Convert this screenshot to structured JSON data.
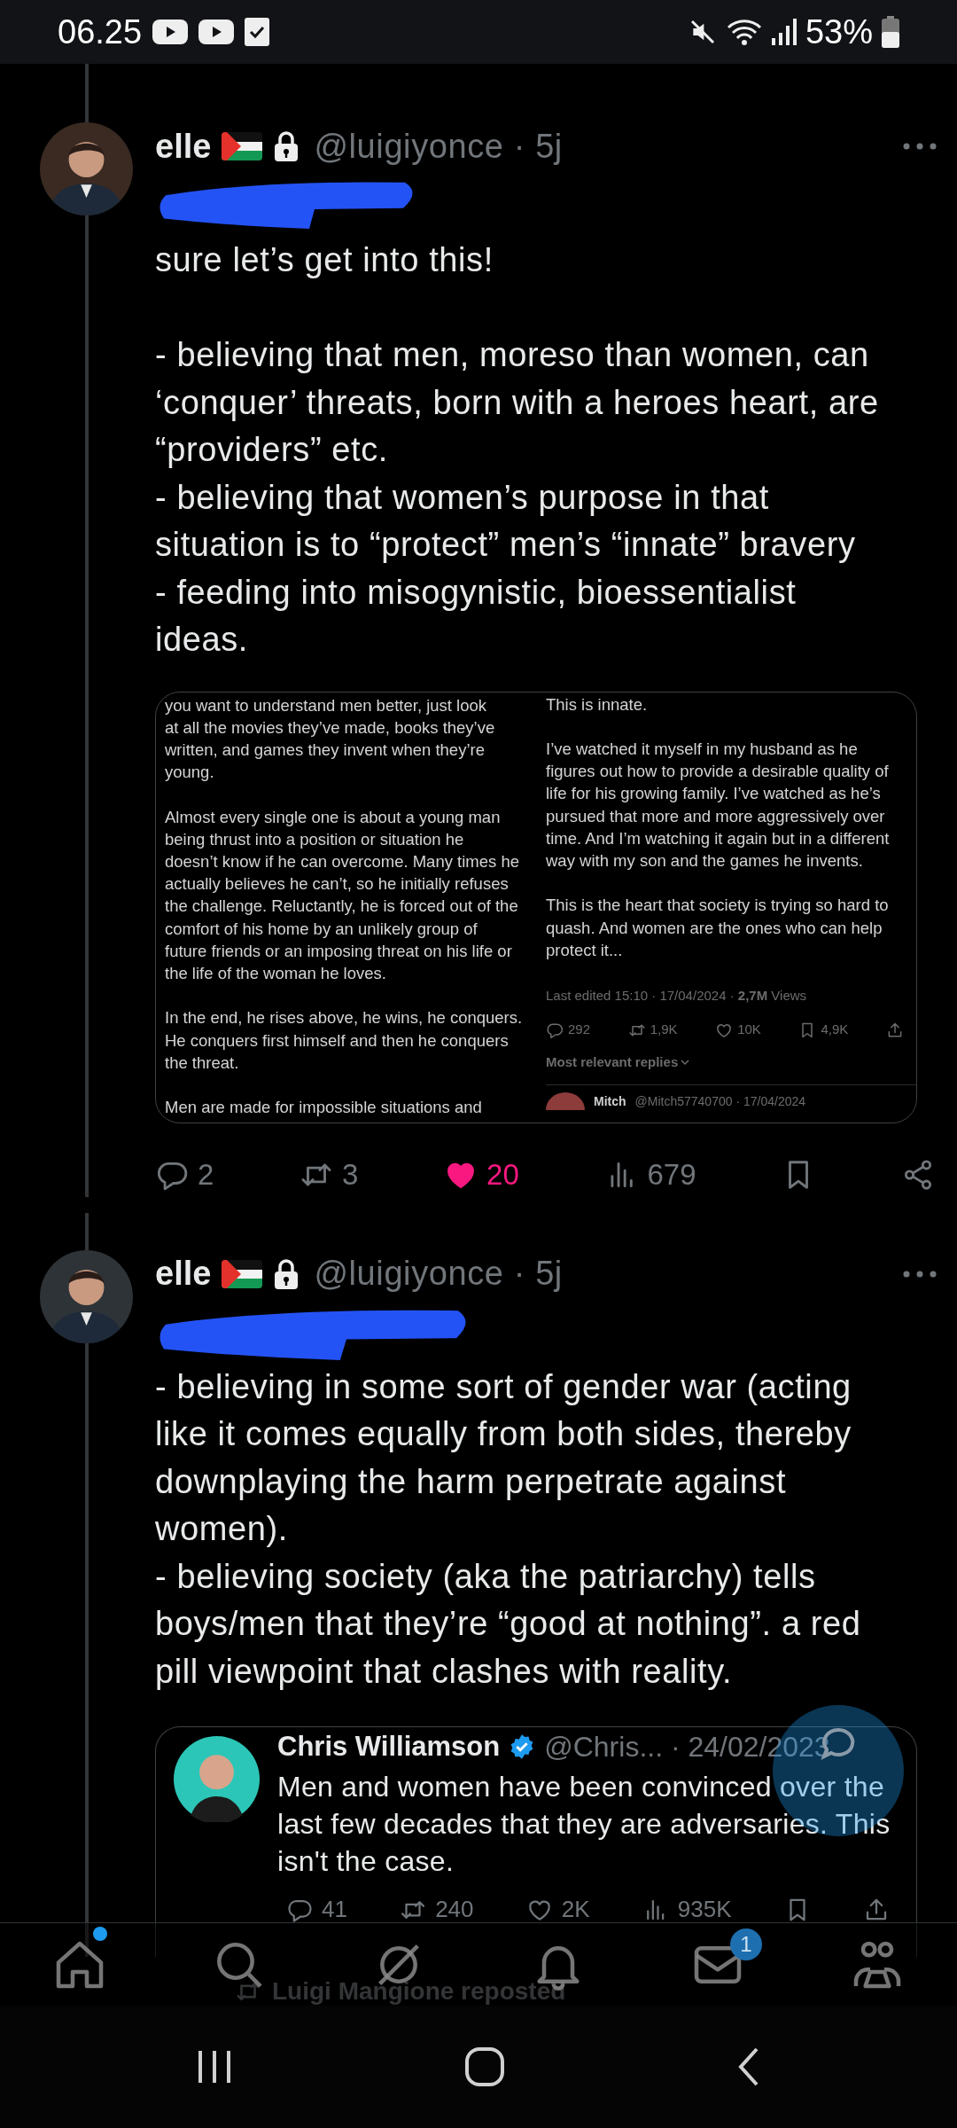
{
  "status_bar": {
    "time": "06.25",
    "battery": "53%"
  },
  "tweets": [
    {
      "name": "elle",
      "protected": true,
      "meta": "@luigiyonce · 5j",
      "text": "sure let’s get into this!\n\n- believing that men, moreso than women, can\n‘conquer’ threats, born with a heroes heart, are\n“providers” etc.\n- believing that women’s purpose in that\nsituation is to “protect” men’s “innate” bravery\n- feeding into misogynistic, bioessentialist\nideas.",
      "media": {
        "left_text": "you want to understand men better, just look\nat all the movies they’ve made, books they’ve\nwritten, and games they invent when they’re\nyoung.\n\nAlmost every single one is about a young man\nbeing thrust into a position or situation he\ndoesn’t know if he can overcome. Many times he\nactually believes he can’t, so he initially refuses\nthe challenge. Reluctantly, he is forced out of the\ncomfort of his home by an unlikely group of\nfuture friends or an imposing threat on his life or\nthe life of the woman he loves.\n\nIn the end, he rises above, he wins, he conquers.\nHe conquers first himself and then he conquers\nthe threat.\n\nMen are made for impossible situations and",
        "right_text": "This is innate.\n\nI’ve watched it myself in my husband as he\nfigures out how to provide a desirable quality of\nlife for his growing family. I’ve watched as he’s\npursued that more and more aggressively over\ntime. And I’m watching it again but in a different\nway with my son and the games he invents.\n\nThis is the heart that society is trying so hard to\nquash. And women are the ones who can help\nprotect it...",
        "meta": "Last edited 15:10 · 17/04/2024 · **2,7M** Views",
        "stats": [
          {
            "kind": "reply",
            "count": "292"
          },
          {
            "kind": "repost",
            "count": "1,9K"
          },
          {
            "kind": "like",
            "count": "10K"
          },
          {
            "kind": "bookmark",
            "count": "4,9K"
          },
          {
            "kind": "upload"
          }
        ],
        "replies_sort": "Most relevant replies",
        "reply_name": "Mitch",
        "reply_meta": "@Mitch57740700 · 17/04/2024"
      },
      "actions": {
        "liked": true,
        "items": [
          {
            "kind": "reply",
            "count": "2"
          },
          {
            "kind": "repost",
            "count": "3"
          },
          {
            "kind": "like",
            "count": "20"
          },
          {
            "kind": "views",
            "count": "679"
          },
          {
            "kind": "bookmark"
          },
          {
            "kind": "share"
          }
        ]
      }
    },
    {
      "name": "elle",
      "protected": true,
      "meta": "@luigiyonce · 5j",
      "text": "-  believing in some sort of gender war (acting\nlike it comes equally from both sides, thereby\ndownplaying the harm perpetrate against\nwomen).\n- believing society (aka the patriarchy) tells\nboys/men that they’re “good at nothing”. a red\npill viewpoint that clashes with reality.",
      "quote": {
        "name": "Chris Williamson",
        "verified": true,
        "meta": "@Chris... · 24/02/2023",
        "text": "Men and women have been convinced over the\nlast few decades that they are adversaries. This\nisn't the case.",
        "actions": {
          "liked": false,
          "items": [
            {
              "kind": "reply",
              "count": "41"
            },
            {
              "kind": "repost",
              "count": "240"
            },
            {
              "kind": "like",
              "count": "2K"
            },
            {
              "kind": "views",
              "count": "935K"
            },
            {
              "kind": "bookmark"
            },
            {
              "kind": "upload"
            }
          ]
        }
      }
    }
  ],
  "next_post": {
    "reposted_by": "Luigi Mangione reposted"
  },
  "bottom_nav": {
    "items": [
      {
        "kind": "home",
        "dot": true
      },
      {
        "kind": "search",
        "dot": false
      },
      {
        "kind": "grok",
        "dot": false
      },
      {
        "kind": "bell",
        "dot": false
      },
      {
        "kind": "mail",
        "dot": false,
        "badge": "1"
      },
      {
        "kind": "people",
        "dot": false
      }
    ]
  }
}
